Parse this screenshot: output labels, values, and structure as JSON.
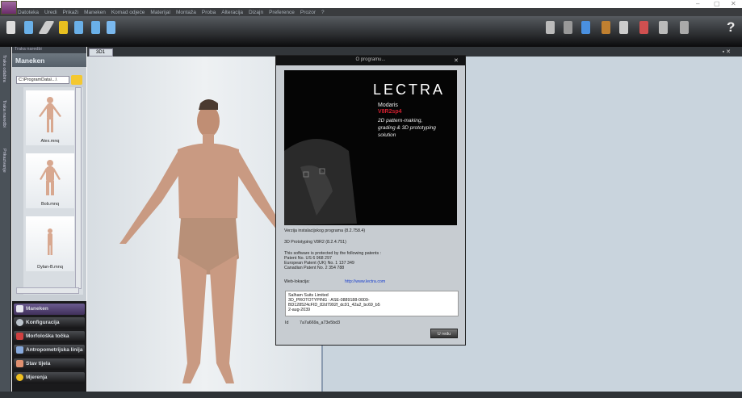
{
  "window": {
    "controls": [
      "–",
      "▢",
      "✕"
    ]
  },
  "menu": [
    "Datoteka",
    "Uredi",
    "Prikaži",
    "Maneken",
    "Komad odjeće",
    "Materijal",
    "Montaža",
    "Proba",
    "Alteracija",
    "Dizajn",
    "Preference",
    "Prozor",
    "?"
  ],
  "toolbar": {
    "help": "?"
  },
  "left_tabs": [
    "Traka odabira",
    "Traka naredbi",
    "Prikazivanje"
  ],
  "panel": {
    "header": "Traka naredbi",
    "title": "Maneken",
    "path": "C:\\ProgramData\\...\\",
    "thumbnails": [
      "Alex.mnq",
      "Bob.mnq",
      "Dylan-B.mnq"
    ],
    "nav": [
      {
        "label": "Maneken",
        "color": "#e8e8f0"
      },
      {
        "label": "Konfiguracija",
        "color": "#bcc4cc"
      },
      {
        "label": "Morfološka točka",
        "color": "#d04040"
      },
      {
        "label": "Antropometrijska linija",
        "color": "#88aadd"
      },
      {
        "label": "Stav tijela",
        "color": "#e09070"
      },
      {
        "label": "Mjerenja",
        "color": "#f0c020"
      }
    ]
  },
  "view": {
    "tab": "3D1"
  },
  "dialog": {
    "title": "O programu...",
    "close": "✕",
    "splash": {
      "brand": "LECTRA",
      "product": "Modaris",
      "version": "V8R2sp4",
      "tagline": [
        "2D pattern-making,",
        "grading & 3D prototyping",
        "solution"
      ]
    },
    "lines": [
      "Verzija instalacijskog programa   (8.2.758.4)",
      "3D Prototyping V8R2   (8.2.4.751)"
    ],
    "patents": [
      "This software  is protected by the following patents :",
      "Patent No. US 6 968 297",
      "European Patent (UK) No. 1 137 349",
      "Canadian Patent No. 2 354 788"
    ],
    "web_label": "Web-lokacija:",
    "web_url": "http://www.lectra.com",
    "license": [
      "Salham Suits Limited",
      "3D_PROTOTYPING : ASE-0889188-0009-BD128524cFID_82d7992f_dc91_42a2_bc69_b5",
      "2-aug-2039"
    ],
    "id_label": "Id",
    "id_value": "7a7a669a_a73e5bd3",
    "ok": "U redu"
  }
}
